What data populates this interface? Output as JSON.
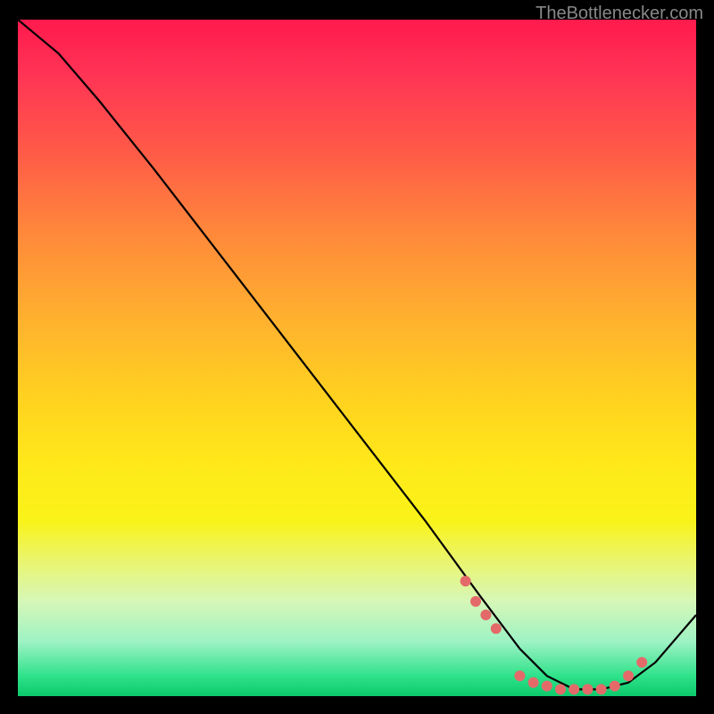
{
  "watermark": "TheBottlenecker.com",
  "chart_data": {
    "type": "line",
    "title": "",
    "xlabel": "",
    "ylabel": "",
    "xlim": [
      0,
      100
    ],
    "ylim": [
      0,
      100
    ],
    "note": "Axes are unlabeled; values below are normalized estimates (0–100) read from pixel positions.",
    "series": [
      {
        "name": "curve",
        "color": "#000000",
        "x": [
          0,
          6,
          12,
          20,
          30,
          40,
          50,
          60,
          68,
          74,
          78,
          82,
          86,
          90,
          94,
          100
        ],
        "y": [
          100,
          95,
          88,
          78,
          65,
          52,
          39,
          26,
          15,
          7,
          3,
          1,
          1,
          2,
          5,
          12
        ]
      }
    ],
    "markers": {
      "name": "highlight-dots",
      "color": "#e46a6a",
      "x": [
        66,
        67.5,
        69,
        70.5,
        74,
        76,
        78,
        80,
        82,
        84,
        86,
        88,
        90,
        92
      ],
      "y": [
        17,
        14,
        12,
        10,
        3,
        2,
        1.5,
        1,
        1,
        1,
        1,
        1.5,
        3,
        5
      ]
    },
    "gradient_background": {
      "orientation": "vertical",
      "stops": [
        {
          "pos": 0.0,
          "color": "#ff1a4d"
        },
        {
          "pos": 0.2,
          "color": "#ff5c47"
        },
        {
          "pos": 0.44,
          "color": "#ffb02f"
        },
        {
          "pos": 0.66,
          "color": "#ffe91a"
        },
        {
          "pos": 0.86,
          "color": "#d6f7b8"
        },
        {
          "pos": 1.0,
          "color": "#0cc96c"
        }
      ]
    }
  }
}
